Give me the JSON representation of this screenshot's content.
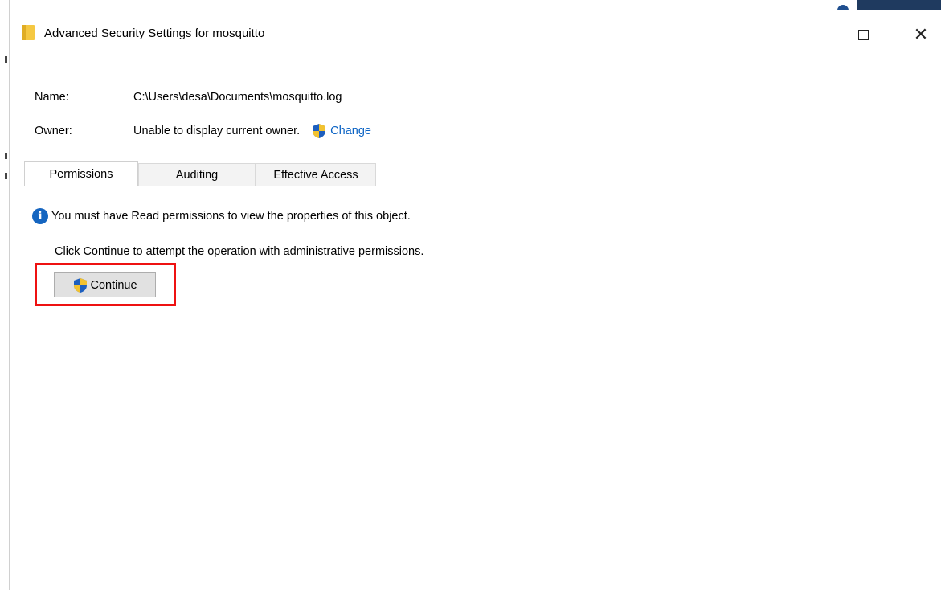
{
  "window": {
    "title": "Advanced Security Settings for mosquitto",
    "minimize_icon": "minimize-icon",
    "maximize_icon": "maximize-icon",
    "close_glyph": "✕"
  },
  "details": {
    "name_label": "Name:",
    "name_value": "C:\\Users\\desa\\Documents\\mosquitto.log",
    "owner_label": "Owner:",
    "owner_value": "Unable to display current owner.",
    "change_link": "Change"
  },
  "tabs": [
    {
      "label": "Permissions",
      "active": true
    },
    {
      "label": "Auditing",
      "active": false
    },
    {
      "label": "Effective Access",
      "active": false
    }
  ],
  "main": {
    "info_message": "You must have Read permissions to view the properties of this object.",
    "instruction": "Click Continue to attempt the operation with administrative permissions.",
    "continue_label": "Continue"
  },
  "colors": {
    "link": "#0b63c4",
    "highlight": "#ee1111",
    "info": "#1565c0"
  }
}
